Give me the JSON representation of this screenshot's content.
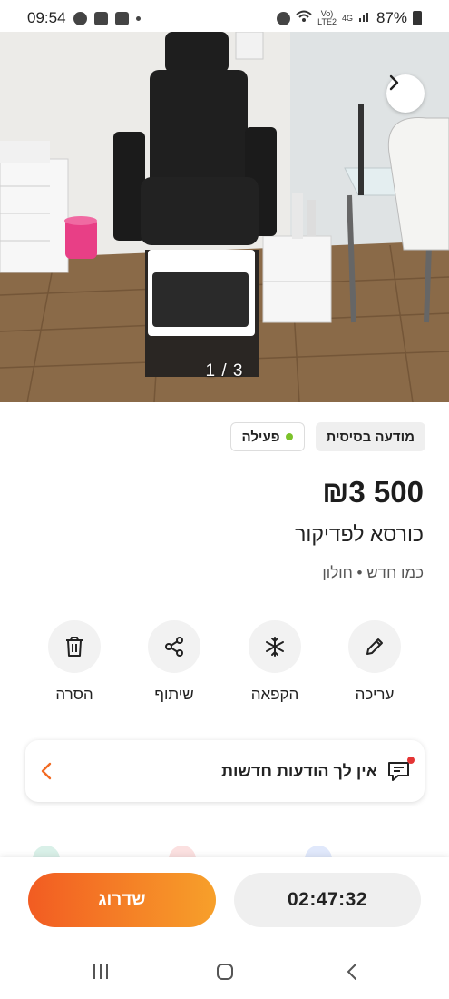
{
  "status_bar": {
    "time": "09:54",
    "network_top": "Vo)",
    "network_bottom": "LTE2",
    "signal": "4G",
    "battery": "87%"
  },
  "gallery": {
    "counter": "1 / 3",
    "next_icon": "chevron-right-icon"
  },
  "badges": {
    "basic": "מודעה בסיסית",
    "status": "פעילה",
    "status_color": "#7cc22a"
  },
  "listing": {
    "price": "₪3 500",
    "title": "כורסא לפדיקור",
    "meta": "כמו חדש • חולון"
  },
  "actions": [
    {
      "label": "עריכה",
      "icon": "pencil-icon"
    },
    {
      "label": "הקפאה",
      "icon": "snowflake-icon"
    },
    {
      "label": "שיתוף",
      "icon": "share-icon"
    },
    {
      "label": "הסרה",
      "icon": "trash-icon"
    }
  ],
  "notifications": {
    "text": "אין לך הודעות חדשות",
    "icon": "chat-icon"
  },
  "bottom": {
    "upgrade_label": "שדרוג",
    "timer": "02:47:32",
    "accent_start": "#f25c22",
    "accent_end": "#f7a02a"
  }
}
